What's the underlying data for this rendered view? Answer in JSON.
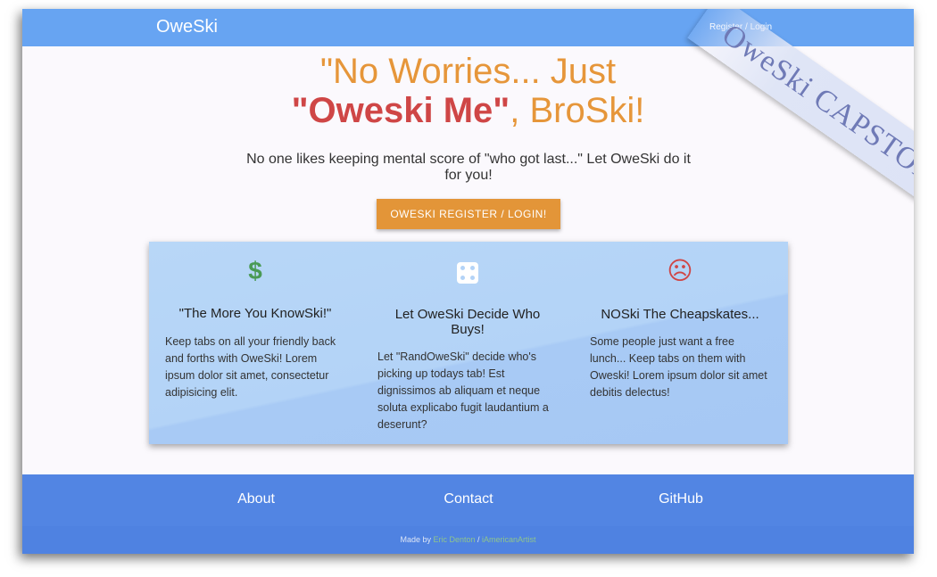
{
  "navbar": {
    "brand": "OweSki",
    "register_login": "Register / Login"
  },
  "ribbon": {
    "text": "OweSki CAPSTONE"
  },
  "hero": {
    "line1": "\"No Worries... Just",
    "line2_bold": "\"Oweski Me\"",
    "line2_rest": ", BroSki!",
    "subtitle": "No one likes keeping mental score of \"who got last...\" Let OweSki do it for you!",
    "cta": "OWESKI REGISTER / LOGIN!"
  },
  "features": [
    {
      "icon": "dollar-icon",
      "glyph": "$",
      "title": "\"The More You KnowSki!\"",
      "text": "Keep tabs on all your friendly back and forths with OweSki! Lorem ipsum dolor sit amet, consectetur adipisicing elit."
    },
    {
      "icon": "dice-icon",
      "glyph": "",
      "title": "Let OweSki Decide Who Buys!",
      "text": "Let \"RandOweSki\" decide who's picking up todays tab! Est dignissimos ab aliquam et neque soluta explicabo fugit laudantium a deserunt?"
    },
    {
      "icon": "frown-icon",
      "glyph": "☹",
      "title": "NOSki The Cheapskates...",
      "text": "Some people just want a free lunch... Keep tabs on them with Oweski! Lorem ipsum dolor sit amet debitis delectus!"
    }
  ],
  "footer": {
    "links": [
      "About",
      "Contact",
      "GitHub"
    ],
    "made_by_prefix": "Made by ",
    "author1": "Eric Denton",
    "separator": " / ",
    "author2": "iAmericanArtist"
  },
  "colors": {
    "nav": "#67a4f2",
    "accent": "#e39538",
    "red": "#cf4646",
    "footer": "#5285e3",
    "feature_bg": "#b3d3f7"
  }
}
